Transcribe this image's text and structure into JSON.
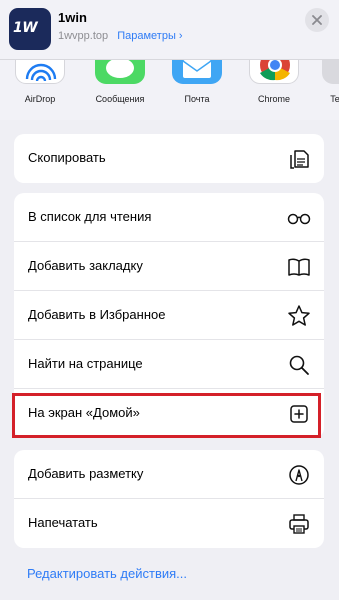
{
  "app": {
    "logo_text": "1W",
    "title": "1win",
    "domain": "1wvpp.top",
    "options_link": "Параметры ›",
    "brand_color": "#1b2a5b"
  },
  "share_targets": [
    {
      "label": "AirDrop",
      "icon": "airdrop-icon"
    },
    {
      "label": "Сообщения",
      "icon": "messages-icon"
    },
    {
      "label": "Почта",
      "icon": "mail-icon"
    },
    {
      "label": "Chrome",
      "icon": "chrome-icon"
    },
    {
      "label": "Te",
      "icon": "app-icon"
    }
  ],
  "actions_group1": [
    {
      "label": "Скопировать",
      "icon": "copy-icon"
    }
  ],
  "actions_group2": [
    {
      "label": "В список для чтения",
      "icon": "glasses-icon"
    },
    {
      "label": "Добавить закладку",
      "icon": "book-icon"
    },
    {
      "label": "Добавить в Избранное",
      "icon": "star-icon"
    },
    {
      "label": "Найти на странице",
      "icon": "search-icon"
    },
    {
      "label": "На экран «Домой»",
      "icon": "add-square-icon",
      "highlighted": true
    }
  ],
  "actions_group3": [
    {
      "label": "Добавить разметку",
      "icon": "markup-icon"
    },
    {
      "label": "Напечатать",
      "icon": "printer-icon"
    }
  ],
  "edit_actions": "Редактировать действия...",
  "colors": {
    "link": "#2f7cf6",
    "highlight_border": "#d42029",
    "background": "#efeff4"
  }
}
